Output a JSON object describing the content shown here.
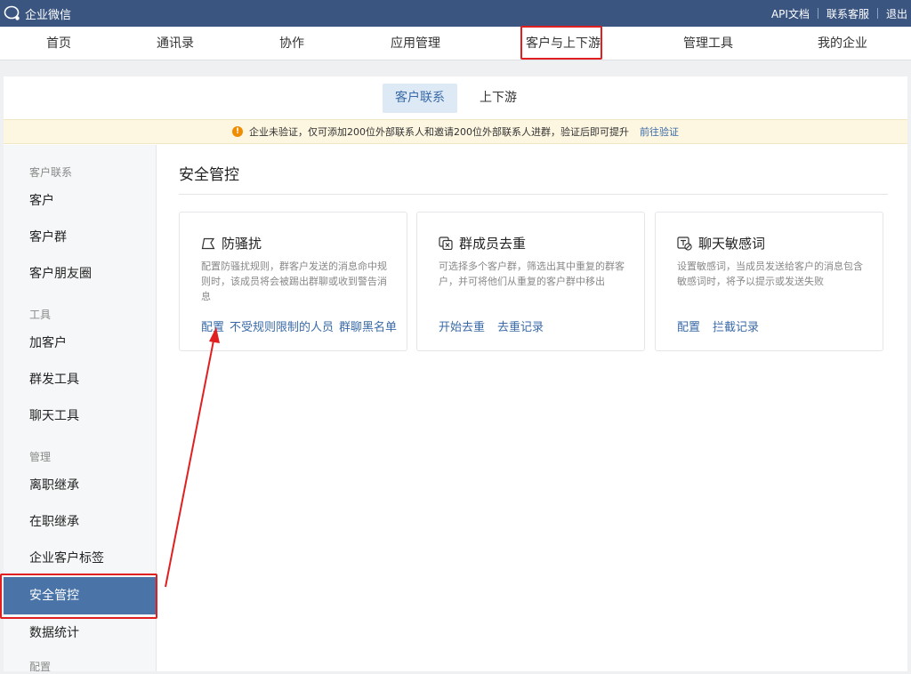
{
  "topbar": {
    "brand": "企业微信",
    "links": [
      "API文档",
      "联系客服",
      "退出"
    ]
  },
  "nav": {
    "items": [
      "首页",
      "通讯录",
      "协作",
      "应用管理",
      "客户与上下游",
      "管理工具",
      "我的企业"
    ],
    "active": "客户与上下游"
  },
  "subtabs": {
    "items": [
      "客户联系",
      "上下游"
    ],
    "active": "客户联系"
  },
  "notice": {
    "text": "企业未验证，仅可添加200位外部联系人和邀请200位外部联系人进群，验证后即可提升",
    "link": "前往验证"
  },
  "sidebar": {
    "groups": [
      {
        "title": "客户联系",
        "items": [
          "客户",
          "客户群",
          "客户朋友圈"
        ]
      },
      {
        "title": "工具",
        "items": [
          "加客户",
          "群发工具",
          "聊天工具"
        ]
      },
      {
        "title": "管理",
        "items": [
          "离职继承",
          "在职继承",
          "企业客户标签",
          "安全管控",
          "数据统计"
        ]
      }
    ],
    "active": "安全管控",
    "partial_next_group": "配置"
  },
  "content": {
    "title": "安全管控",
    "cards": [
      {
        "icon": "flag-icon",
        "title": "防骚扰",
        "desc": "配置防骚扰规则，群客户发送的消息命中规则时，该成员将会被踢出群聊或收到警告消息",
        "actions": [
          "配置",
          "不受规则限制的人员",
          "群聊黑名单"
        ]
      },
      {
        "icon": "dedupe-icon",
        "title": "群成员去重",
        "desc": "可选择多个客户群，筛选出其中重复的群客户，并可将他们从重复的客户群中移出",
        "actions": [
          "开始去重",
          "去重记录"
        ]
      },
      {
        "icon": "sensitive-word-icon",
        "title": "聊天敏感词",
        "desc": "设置敏感词，当成员发送给客户的消息包含敏感词时，将予以提示或发送失败",
        "actions": [
          "配置",
          "拦截记录"
        ]
      }
    ]
  },
  "colors": {
    "topbar": "#3a5580",
    "accent": "#3a6aa8",
    "sidebar_active": "#4a73a8",
    "highlight": "#e02020",
    "notice_bg": "#fdf6e0"
  }
}
